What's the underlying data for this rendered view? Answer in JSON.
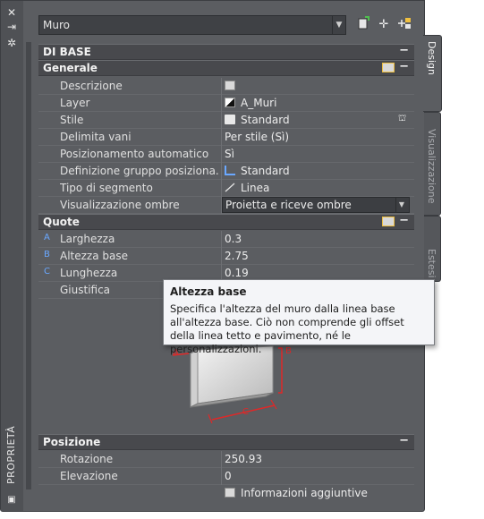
{
  "palette": {
    "title": "PROPRIETÀ"
  },
  "combo": {
    "value": "Muro"
  },
  "toolbar": {
    "icons": [
      "add-style-icon",
      "select-objects-icon",
      "quick-select-icon"
    ]
  },
  "categories": {
    "di_base": "DI BASE",
    "generale": "Generale",
    "quote": "Quote",
    "posizione": "Posizione"
  },
  "generale_rows": [
    {
      "label": "Descrizione",
      "value": ""
    },
    {
      "label": "Layer",
      "value": "A_Muri"
    },
    {
      "label": "Stile",
      "value": "Standard"
    },
    {
      "label": "Delimita vani",
      "value": "Per stile (Sì)"
    },
    {
      "label": "Posizionamento automatico",
      "value": "Sì"
    },
    {
      "label": "Definizione gruppo posiziona...",
      "value": "Standard"
    },
    {
      "label": "Tipo di segmento",
      "value": "Linea"
    },
    {
      "label": "Visualizzazione ombre",
      "value": "Proietta e riceve ombre"
    }
  ],
  "quote_rows": [
    {
      "marker": "A",
      "label": "Larghezza",
      "value": "0.3"
    },
    {
      "marker": "B",
      "label": "Altezza base",
      "value": "2.75"
    },
    {
      "marker": "C",
      "label": "Lunghezza",
      "value": "0.19"
    },
    {
      "marker": "",
      "label": "Giustifica",
      "value": ""
    }
  ],
  "illustration": {
    "labels": [
      "A",
      "B",
      "C"
    ]
  },
  "posizione_rows": [
    {
      "label": "Rotazione",
      "value": "250.93"
    },
    {
      "label": "Elevazione",
      "value": "0"
    }
  ],
  "extra_info": "Informazioni aggiuntive",
  "tabs": [
    "Design",
    "Visualizzazione",
    "Estesi"
  ],
  "tooltip": {
    "title": "Altezza base",
    "body": "Specifica l'altezza del muro dalla linea base all'altezza base. Ciò non comprende gli offset della linea tetto e pavimento, né le personalizzazioni."
  },
  "colors": {
    "panel": "#5b5d61",
    "category": "#48494d",
    "marker": "#6aa8ff",
    "illustration_dim": "#e02828"
  }
}
